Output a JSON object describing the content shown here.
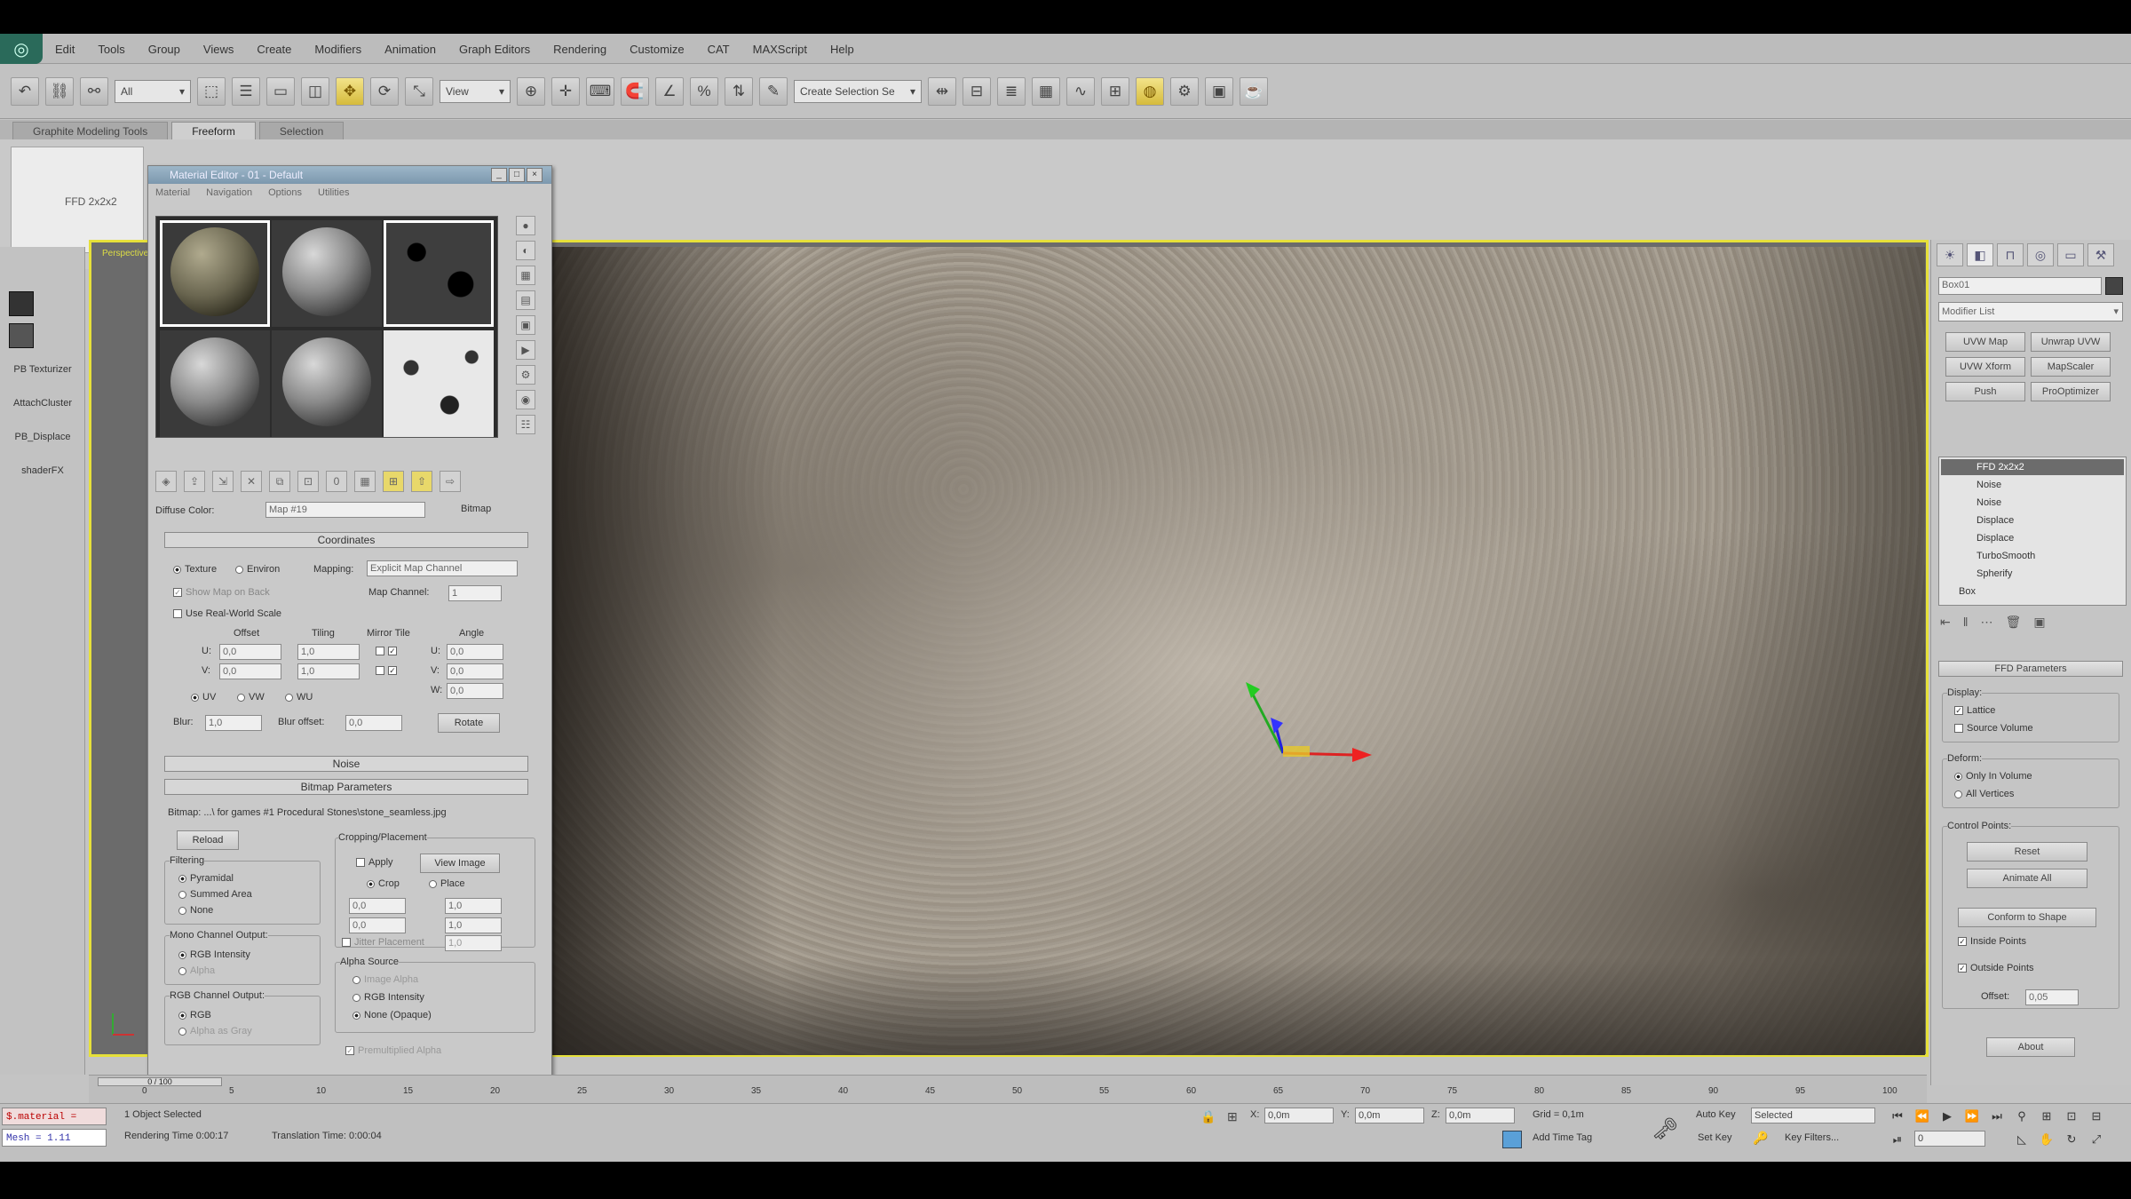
{
  "menu": [
    "Edit",
    "Tools",
    "Group",
    "Views",
    "Create",
    "Modifiers",
    "Animation",
    "Graph Editors",
    "Rendering",
    "Customize",
    "CAT",
    "MAXScript",
    "Help"
  ],
  "toolbar": {
    "selection_filter": "All",
    "ref_coord": "View",
    "named_selection": "Create Selection Se"
  },
  "ribbon": {
    "tabs": [
      "Graphite Modeling Tools",
      "Freeform",
      "Selection"
    ],
    "active_tab": "Freeform",
    "panel_label": "FFD 2x2x2"
  },
  "left_strip": {
    "items": [
      "PB Texturizer",
      "AttachCluster",
      "PB_Displace",
      "shaderFX"
    ]
  },
  "viewport": {
    "label": "Perspective"
  },
  "material_editor": {
    "title": "Material Editor - 01 - Default",
    "menu": [
      "Material",
      "Navigation",
      "Options",
      "Utilities"
    ],
    "map_label": "Diffuse Color:",
    "map_name": "Map #19",
    "map_type": "Bitmap",
    "coords_rollout": "Coordinates",
    "texture_label": "Texture",
    "environ_label": "Environ",
    "mapping_label": "Mapping:",
    "mapping_value": "Explicit Map Channel",
    "show_map_back": "Show Map on Back",
    "map_channel_label": "Map Channel:",
    "map_channel_value": "1",
    "real_world": "Use Real-World Scale",
    "col_offset": "Offset",
    "col_tiling": "Tiling",
    "col_mirror_tile": "Mirror Tile",
    "col_angle": "Angle",
    "u_label": "U:",
    "v_label": "V:",
    "w_label": "W:",
    "offset_u": "0,0",
    "offset_v": "0,0",
    "tiling_u": "1,0",
    "tiling_v": "1,0",
    "angle_u": "0,0",
    "angle_v": "0,0",
    "angle_w": "0,0",
    "uv_label": "UV",
    "vw_label": "VW",
    "wu_label": "WU",
    "blur_label": "Blur:",
    "blur_value": "1,0",
    "blur_offset_label": "Blur offset:",
    "blur_offset_value": "0,0",
    "rotate_btn": "Rotate",
    "noise_rollout": "Noise",
    "bitmap_params_rollout": "Bitmap Parameters",
    "bitmap_path": "Bitmap: ...\\ for games #1 Procedural Stones\\stone_seamless.jpg",
    "reload_btn": "Reload",
    "cropping_group": "Cropping/Placement",
    "apply_label": "Apply",
    "view_image_btn": "View Image",
    "crop_label": "Crop",
    "place_label": "Place",
    "u_value": "0,0",
    "v_value": "0,0",
    "w_value": "1,0",
    "h_value": "1,0",
    "jitter_label": "Jitter Placement",
    "jitter_value": "1,0",
    "filtering_group": "Filtering",
    "pyramidal": "Pyramidal",
    "summed_area": "Summed Area",
    "none_label": "None",
    "mono_group": "Mono Channel Output:",
    "rgb_intensity": "RGB Intensity",
    "alpha_label": "Alpha",
    "rgb_out_group": "RGB Channel Output:",
    "rgb_label": "RGB",
    "alpha_as_gray": "Alpha as Gray",
    "alpha_source_group": "Alpha Source",
    "image_alpha": "Image Alpha",
    "rgb_intensity2": "RGB Intensity",
    "none_opaque": "None (Opaque)",
    "premult": "Premultiplied Alpha"
  },
  "command_panel": {
    "object_name": "Box01",
    "modifier_list": "Modifier List",
    "buttons": [
      "UVW Map",
      "Unwrap UVW",
      "UVW Xform",
      "MapScaler",
      "Push",
      "ProOptimizer"
    ],
    "stack": [
      "FFD 2x2x2",
      "Noise",
      "Noise",
      "Displace",
      "Displace",
      "TurboSmooth",
      "Spherify",
      "Box"
    ],
    "ffd_params_rollout": "FFD Parameters",
    "display_group": "Display:",
    "lattice": "Lattice",
    "source_volume": "Source Volume",
    "deform_group": "Deform:",
    "only_in_volume": "Only In Volume",
    "all_vertices": "All Vertices",
    "control_points_group": "Control Points:",
    "reset_btn": "Reset",
    "animate_all_btn": "Animate All",
    "conform_btn": "Conform to Shape",
    "inside_points": "Inside Points",
    "outside_points": "Outside Points",
    "offset_label": "Offset:",
    "offset_value": "0,05",
    "about_btn": "About"
  },
  "timeline": {
    "slider_label": "0 / 100",
    "ticks": [
      "0",
      "5",
      "10",
      "15",
      "20",
      "25",
      "30",
      "35",
      "40",
      "45",
      "50",
      "55",
      "60",
      "65",
      "70",
      "75",
      "80",
      "85",
      "90",
      "95",
      "100"
    ]
  },
  "status": {
    "maxscript_line1": "$.material =",
    "maxscript_line2": "Mesh = 1.11",
    "selected": "1 Object Selected",
    "render_time": "Rendering Time 0:00:17",
    "translation_time": "Translation Time: 0:00:04",
    "x_label": "X:",
    "x_value": "0,0m",
    "y_label": "Y:",
    "y_value": "0,0m",
    "z_label": "Z:",
    "z_value": "0,0m",
    "grid": "Grid = 0,1m",
    "add_time_tag": "Add Time Tag",
    "auto_key": "Auto Key",
    "set_key": "Set Key",
    "key_mode": "Selected",
    "key_filters": "Key Filters...",
    "frame_value": "0"
  },
  "colors": {
    "viewport_border": "#e6e03a",
    "title_bar": "#7c98ae",
    "maxscript_error": "#b00000"
  }
}
